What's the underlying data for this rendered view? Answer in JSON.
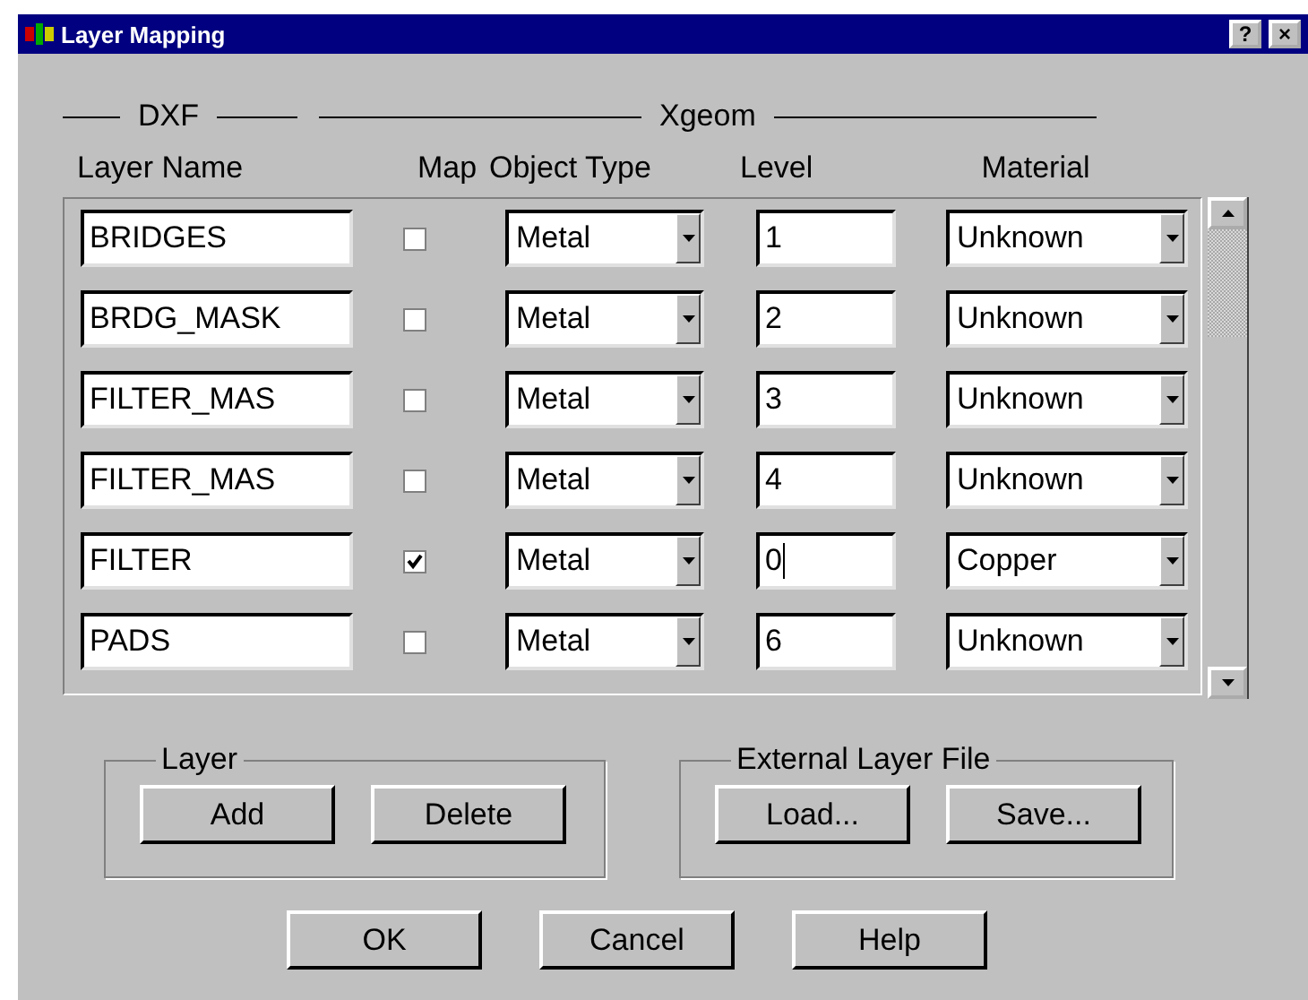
{
  "window": {
    "title": "Layer Mapping",
    "title_buttons": [
      "?",
      "×"
    ]
  },
  "group_headers": [
    "DXF",
    "Xgeom"
  ],
  "columns": [
    "Layer Name",
    "Map",
    "Object Type",
    "Level",
    "Material"
  ],
  "rows": [
    {
      "name": "BRIDGES",
      "checked": false,
      "object_type": "Metal",
      "level": "1",
      "material": "Unknown",
      "focused": false
    },
    {
      "name": "BRDG_MASK",
      "checked": false,
      "object_type": "Metal",
      "level": "2",
      "material": "Unknown",
      "focused": false
    },
    {
      "name": "FILTER_MAS",
      "checked": false,
      "object_type": "Metal",
      "level": "3",
      "material": "Unknown",
      "focused": false
    },
    {
      "name": "FILTER_MAS",
      "checked": false,
      "object_type": "Metal",
      "level": "4",
      "material": "Unknown",
      "focused": false
    },
    {
      "name": "FILTER",
      "checked": true,
      "object_type": "Metal",
      "level": "0",
      "material": "Copper",
      "focused": true
    },
    {
      "name": "PADS",
      "checked": false,
      "object_type": "Metal",
      "level": "6",
      "material": "Unknown",
      "focused": false
    }
  ],
  "groups": [
    {
      "title": "Layer",
      "buttons": [
        "Add",
        "Delete"
      ]
    },
    {
      "title": "External Layer File",
      "buttons": [
        "Load...",
        "Save..."
      ]
    }
  ],
  "buttons": [
    "OK",
    "Cancel",
    "Help"
  ]
}
